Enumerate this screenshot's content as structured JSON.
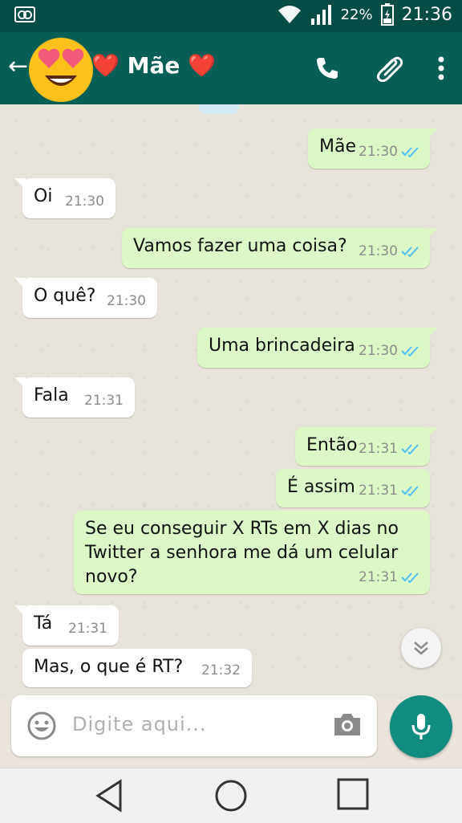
{
  "status_bar": {
    "battery": "22%",
    "time": "21:36",
    "icons": [
      "voicemail-icon",
      "wifi-icon",
      "signal-icon",
      "battery-icon"
    ]
  },
  "header": {
    "title": "❤️ Mãe ❤️",
    "avatar_icon": "heart-eyes-emoji",
    "icons": [
      "back-arrow-icon",
      "phone-icon",
      "paperclip-icon",
      "more-vert-icon"
    ],
    "color": "#075e54"
  },
  "messages": [
    {
      "direction": "out",
      "text": "Mãe",
      "time": "21:30",
      "status": "read"
    },
    {
      "direction": "in",
      "text": "Oi",
      "time": "21:30"
    },
    {
      "direction": "out",
      "text": "Vamos fazer uma coisa?",
      "time": "21:30",
      "status": "read"
    },
    {
      "direction": "in",
      "text": "O quê?",
      "time": "21:30"
    },
    {
      "direction": "out",
      "text": "Uma brincadeira",
      "time": "21:30",
      "status": "read"
    },
    {
      "direction": "in",
      "text": "Fala",
      "time": "21:31"
    },
    {
      "direction": "out",
      "text": "Então",
      "time": "21:31",
      "status": "read"
    },
    {
      "direction": "out",
      "text": "É assim",
      "time": "21:31",
      "status": "read"
    },
    {
      "direction": "out",
      "text": "Se eu conseguir X RTs em X dias no Twitter a senhora me dá um celular novo?",
      "time": "21:31",
      "status": "read"
    },
    {
      "direction": "in",
      "text": "Tá",
      "time": "21:31"
    },
    {
      "direction": "in",
      "text": "Mas, o que é RT?",
      "time": "21:32"
    }
  ],
  "composer": {
    "placeholder": "Digite aqui...",
    "icons": [
      "emoji-icon",
      "camera-icon",
      "mic-icon"
    ]
  },
  "navigation": {
    "icons": [
      "back-icon",
      "home-icon",
      "recents-icon"
    ]
  },
  "colors": {
    "incoming": "#ffffff",
    "outgoing": "#dcf8c6",
    "read_tick": "#4fc3f7",
    "accent": "#128c7e"
  }
}
